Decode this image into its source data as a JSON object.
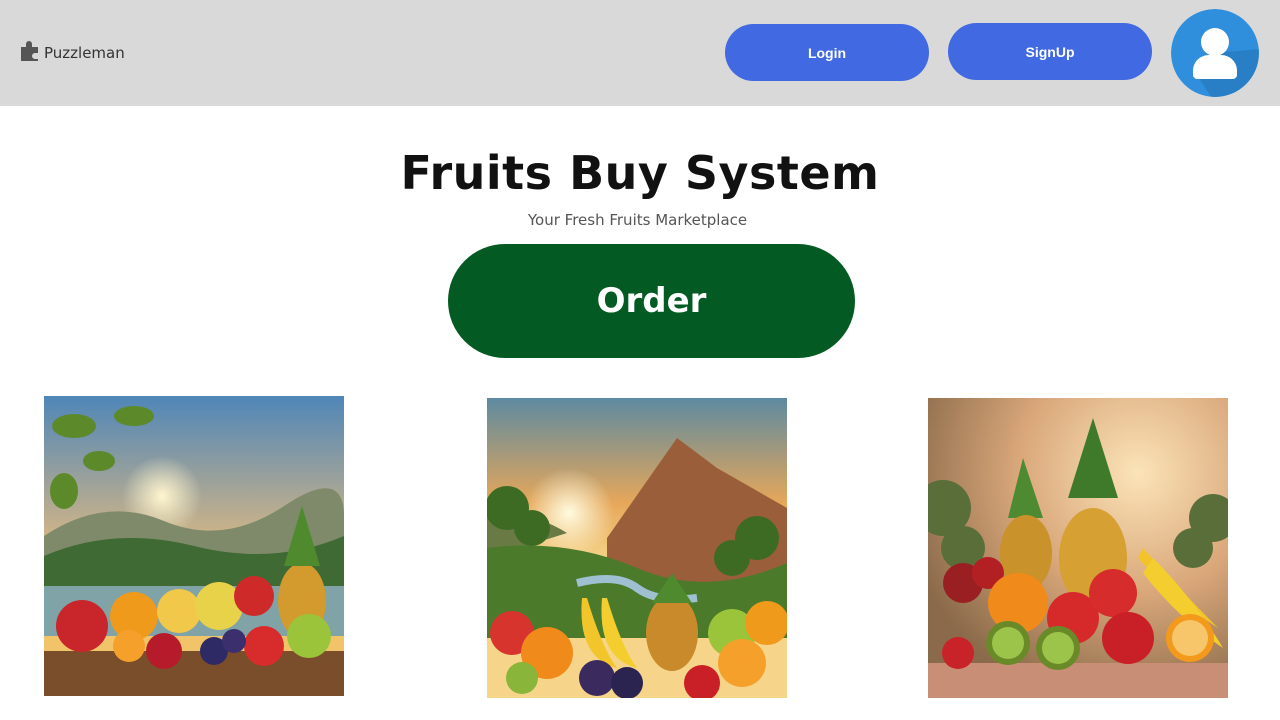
{
  "header": {
    "brand_name": "Puzzleman",
    "brand_icon": "puzzle-icon",
    "login_label": "Login",
    "signup_label": "SignUp",
    "avatar_icon": "user-avatar-icon"
  },
  "hero": {
    "title": "Fruits Buy System",
    "subtitle": "Your Fresh Fruits Marketplace",
    "order_label": "Order"
  },
  "gallery": {
    "images": [
      {
        "name": "fruit-image-lake-sunset"
      },
      {
        "name": "fruit-image-valley-sunset"
      },
      {
        "name": "fruit-image-pineapple-display"
      }
    ]
  },
  "colors": {
    "topbar_bg": "#d9d9d9",
    "button_blue": "#4169e1",
    "order_green": "#035a22",
    "avatar_blue": "#2f8fdc"
  }
}
